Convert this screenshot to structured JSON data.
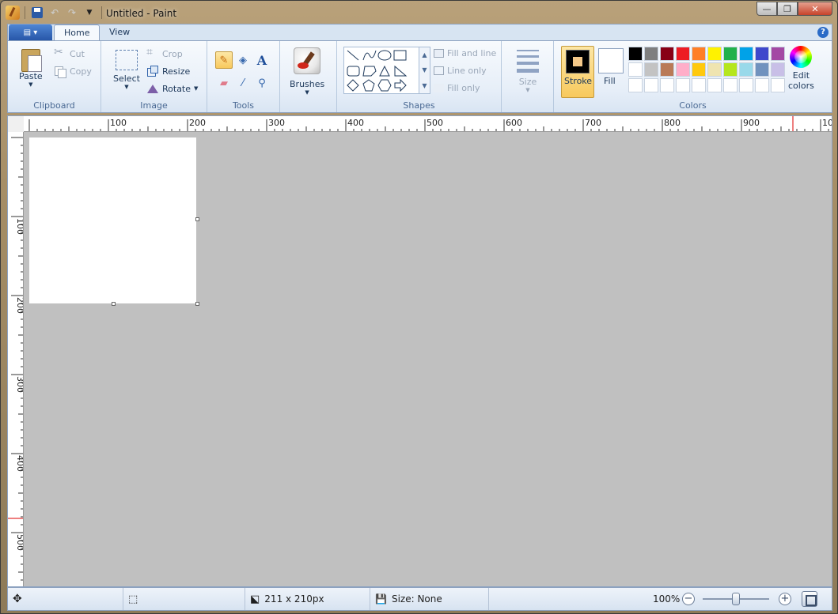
{
  "window": {
    "title": "Untitled - Paint",
    "controls": {
      "minimize": "—",
      "maximize": "❐",
      "close": "✕"
    }
  },
  "quick_access": {
    "icons": [
      "paint-app-icon",
      "save-icon",
      "undo-icon",
      "redo-icon",
      "customize-dropdown-icon"
    ]
  },
  "ribbon": {
    "tabs": [
      {
        "label": "Home",
        "active": true
      },
      {
        "label": "View",
        "active": false
      }
    ],
    "help": "?",
    "groups": {
      "clipboard": {
        "label": "Clipboard",
        "paste": "Paste",
        "cut": "Cut",
        "copy": "Copy"
      },
      "image": {
        "label": "Image",
        "select": "Select",
        "crop": "Crop",
        "resize": "Resize",
        "rotate": "Rotate"
      },
      "tools": {
        "label": "Tools",
        "items": [
          "pencil",
          "fill-bucket",
          "text",
          "eraser",
          "color-picker",
          "magnifier"
        ]
      },
      "brushes": {
        "label": "Brushes"
      },
      "shapes": {
        "label": "Shapes",
        "fill_and_line": "Fill and line",
        "line_only": "Line only",
        "fill_only": "Fill only"
      },
      "size": {
        "label": "Size"
      },
      "colors": {
        "label": "Colors",
        "stroke": "Stroke",
        "fill": "Fill",
        "edit_colors_line1": "Edit",
        "edit_colors_line2": "colors",
        "palette": [
          "#000000",
          "#7f7f7f",
          "#880015",
          "#ed1c24",
          "#ff7f27",
          "#fff200",
          "#22b14c",
          "#00a2e8",
          "#3f48cc",
          "#a349a4",
          "#ffffff",
          "#c3c3c3",
          "#b97a57",
          "#ffaec9",
          "#ffc90e",
          "#efe4b0",
          "#b5e61d",
          "#99d9ea",
          "#7092be",
          "#c8bfe7",
          "#ffffff",
          "#ffffff",
          "#ffffff",
          "#ffffff",
          "#ffffff",
          "#ffffff",
          "#ffffff",
          "#ffffff",
          "#ffffff",
          "#ffffff"
        ],
        "stroke_color": "#000000",
        "fill_color": "#ffffff"
      }
    }
  },
  "rulers": {
    "horizontal_labels": [
      "100",
      "200",
      "300",
      "400",
      "500",
      "600",
      "700",
      "800",
      "900",
      "10"
    ],
    "vertical_labels": [
      "100",
      "200",
      "300",
      "400",
      "500"
    ]
  },
  "status_bar": {
    "selection_size": "211 x 210px",
    "file_size": "Size: None",
    "zoom": "100%"
  }
}
